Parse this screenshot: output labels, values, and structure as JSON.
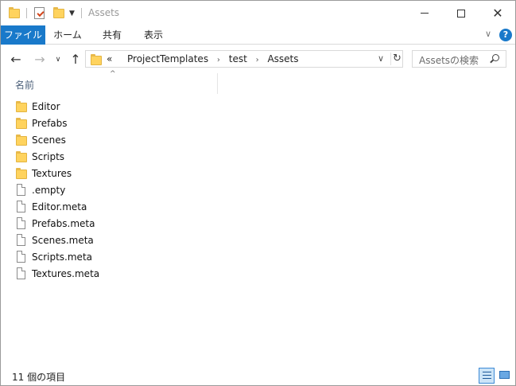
{
  "window": {
    "title": "Assets",
    "minimize_label": "minimize",
    "maximize_label": "maximize",
    "close_label": "close"
  },
  "ribbon": {
    "tabs": [
      {
        "label": "ファイル",
        "active": true
      },
      {
        "label": "ホーム"
      },
      {
        "label": "共有"
      },
      {
        "label": "表示"
      }
    ],
    "help": "?"
  },
  "nav": {
    "overflow": "«",
    "breadcrumbs": [
      "ProjectTemplates",
      "test",
      "Assets"
    ],
    "search_placeholder": "Assetsの検索"
  },
  "list": {
    "column_name": "名前",
    "items": [
      {
        "name": "Editor",
        "type": "folder"
      },
      {
        "name": "Prefabs",
        "type": "folder"
      },
      {
        "name": "Scenes",
        "type": "folder"
      },
      {
        "name": "Scripts",
        "type": "folder"
      },
      {
        "name": "Textures",
        "type": "folder"
      },
      {
        "name": ".empty",
        "type": "file"
      },
      {
        "name": "Editor.meta",
        "type": "file"
      },
      {
        "name": "Prefabs.meta",
        "type": "file"
      },
      {
        "name": "Scenes.meta",
        "type": "file"
      },
      {
        "name": "Scripts.meta",
        "type": "file"
      },
      {
        "name": "Textures.meta",
        "type": "file"
      }
    ]
  },
  "status": {
    "item_count": "11 個の項目"
  },
  "colors": {
    "accent": "#1979ca",
    "folder": "#ffd35e"
  }
}
